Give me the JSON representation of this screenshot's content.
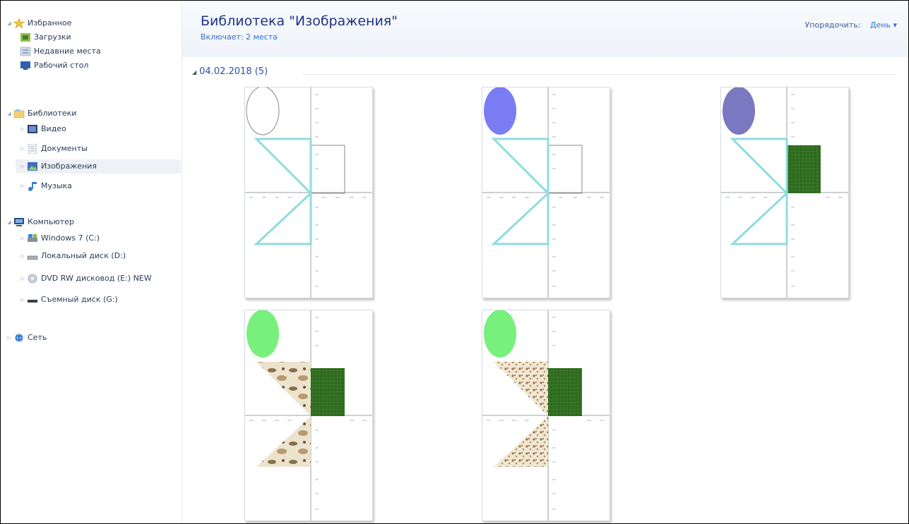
{
  "sidebar": {
    "favorites": {
      "label": "Избранное",
      "items": [
        {
          "label": "Загрузки",
          "icon": "downloads-icon"
        },
        {
          "label": "Недавние места",
          "icon": "recent-places-icon"
        },
        {
          "label": "Рабочий стол",
          "icon": "desktop-icon"
        }
      ]
    },
    "libraries": {
      "label": "Библиотеки",
      "items": [
        {
          "label": "Видео",
          "icon": "video-icon"
        },
        {
          "label": "Документы",
          "icon": "documents-icon"
        },
        {
          "label": "Изображения",
          "icon": "pictures-icon",
          "selected": true
        },
        {
          "label": "Музыка",
          "icon": "music-icon"
        }
      ]
    },
    "computer": {
      "label": "Компьютер",
      "items": [
        {
          "label": "Windows 7 (C:)",
          "icon": "system-drive-icon"
        },
        {
          "label": "Локальный диск (D:)",
          "icon": "local-disk-icon"
        },
        {
          "label": "DVD RW дисковод (E:) NEW",
          "icon": "dvd-drive-icon"
        },
        {
          "label": "Съемный диск (G:)",
          "icon": "removable-disk-icon"
        }
      ]
    },
    "network": {
      "label": "Сеть",
      "icon": "network-icon"
    }
  },
  "library": {
    "title": "Библиотека \"Изображения\"",
    "includes_prefix": "Включает:",
    "includes_link": "2 места",
    "arrange_label": "Упорядочить:",
    "arrange_value": "День ▾"
  },
  "group": {
    "label": "04.02.2018 (5)"
  },
  "colors": {
    "title": "#1e3287",
    "link": "#2f6fe0",
    "sky_stroke": "#8fdcdf",
    "green_rect": "#2e6a1e",
    "oval_blue": "#7a7cf4",
    "oval_purple": "#7a78c0",
    "oval_green": "#77f07d"
  },
  "thumbnails": [
    {
      "oval": "outline",
      "fill": "outline",
      "rect": "outline"
    },
    {
      "oval": "blue",
      "fill": "outline",
      "rect": "outline"
    },
    {
      "oval": "purple",
      "fill": "outline",
      "rect": "green"
    },
    {
      "oval": "green",
      "fill": "texture-coarse",
      "rect": "green"
    },
    {
      "oval": "green",
      "fill": "texture-fine",
      "rect": "green"
    }
  ]
}
